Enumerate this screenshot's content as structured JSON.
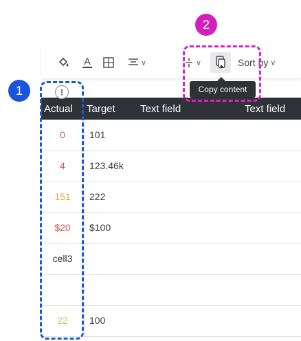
{
  "annotations": {
    "badge_1": "1",
    "badge_2": "2"
  },
  "toolbar": {
    "sort_label": "Sort by",
    "tooltip": "Copy content",
    "icons": [
      "fill-color-icon",
      "text-color-icon",
      "borders-icon",
      "align-icon",
      "vertical-align-icon",
      "copy-content-icon"
    ]
  },
  "column_handle": "⋮",
  "table": {
    "headers": [
      "Actual",
      "Target",
      "Text field",
      "Text field"
    ],
    "rows": [
      {
        "actual": "0",
        "actual_color": "#d9534f",
        "target": "101"
      },
      {
        "actual": "4",
        "actual_color": "#d9534f",
        "target": "123.46k"
      },
      {
        "actual": "151",
        "actual_color": "#e0a24a",
        "target": "222"
      },
      {
        "actual": "$20",
        "actual_color": "#d9534f",
        "target": "$100"
      },
      {
        "actual": "cell3",
        "actual_color": "#333333",
        "target": ""
      },
      {
        "actual": "",
        "actual_color": "#333333",
        "target": ""
      },
      {
        "actual": "22",
        "actual_color": "#c9c27a",
        "target": "100"
      }
    ]
  },
  "colors": {
    "highlight_blue": "#1a56db",
    "highlight_pink": "#e01fc8",
    "header_bg": "#2f3338"
  }
}
